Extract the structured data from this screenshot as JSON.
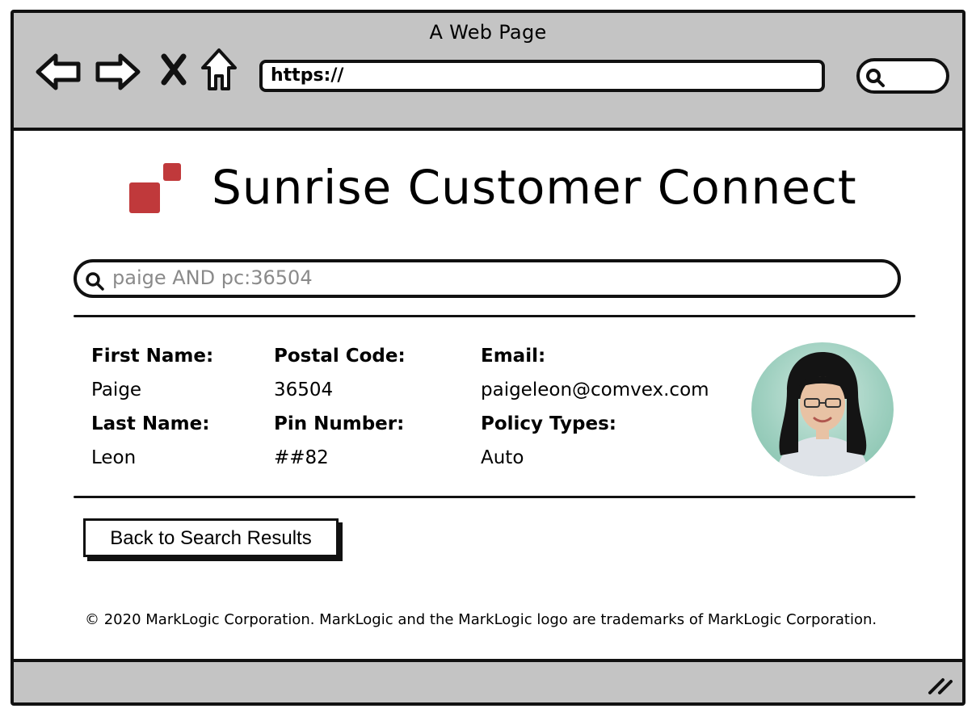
{
  "browser": {
    "window_title": "A Web Page",
    "url": "https://"
  },
  "app": {
    "title": "Sunrise Customer Connect",
    "brand_color": "#c0393b"
  },
  "search": {
    "query": "paige AND pc:36504"
  },
  "customer": {
    "first_name_label": "First Name:",
    "first_name": "Paige",
    "last_name_label": "Last Name:",
    "last_name": "Leon",
    "postal_code_label": "Postal Code:",
    "postal_code": "36504",
    "pin_label": "Pin Number:",
    "pin": "##82",
    "email_label": "Email:",
    "email": "paigeleon@comvex.com",
    "policy_types_label": "Policy Types:",
    "policy_types": "Auto"
  },
  "actions": {
    "back_label": "Back to Search Results"
  },
  "footer": {
    "text": "© 2020 MarkLogic Corporation. MarkLogic and the MarkLogic logo are trademarks of MarkLogic Corporation."
  }
}
